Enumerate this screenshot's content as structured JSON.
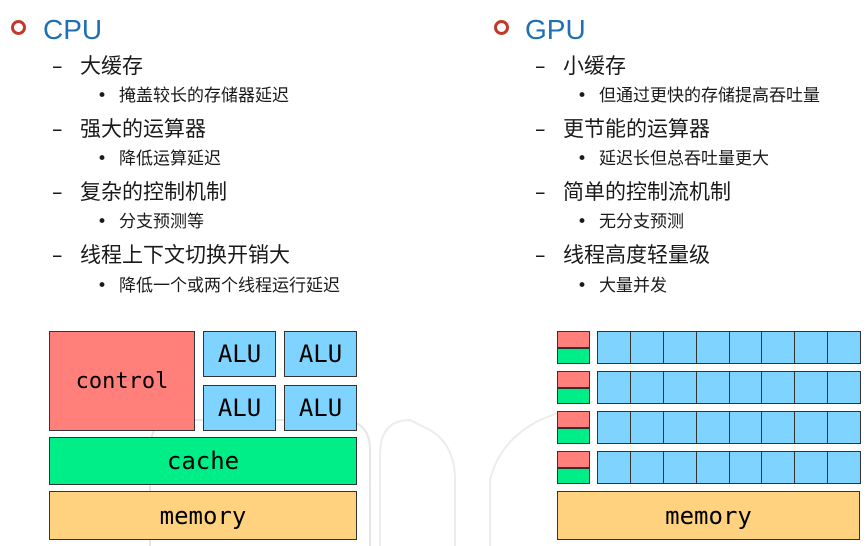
{
  "cpu": {
    "heading": "CPU",
    "items": [
      {
        "title": "大缓存",
        "sub": "掩盖较长的存储器延迟"
      },
      {
        "title": "强大的运算器",
        "sub": "降低运算延迟"
      },
      {
        "title": "复杂的控制机制",
        "sub": "分支预测等"
      },
      {
        "title": "线程上下文切换开销大",
        "sub": "降低一个或两个线程运行延迟"
      }
    ],
    "diagram": {
      "control": "control",
      "alu": [
        "ALU",
        "ALU",
        "ALU",
        "ALU"
      ],
      "cache": "cache",
      "memory": "memory"
    }
  },
  "gpu": {
    "heading": "GPU",
    "items": [
      {
        "title": "小缓存",
        "sub": "但通过更快的存储提高吞吐量"
      },
      {
        "title": "更节能的运算器",
        "sub": "延迟长但总吞吐量更大"
      },
      {
        "title": "简单的控制流机制",
        "sub": "无分支预测"
      },
      {
        "title": "线程高度轻量级",
        "sub": "大量并发"
      }
    ],
    "diagram": {
      "rows": 4,
      "alus_per_row": 8,
      "memory": "memory"
    }
  },
  "symbols": {
    "dash": "–",
    "bullet": "•"
  },
  "colors": {
    "heading": "#1f6fb4",
    "bullet_ring": "#c0392b",
    "control": "#ff7f7a",
    "alu": "#7fd3ff",
    "cache": "#00ee88",
    "memory": "#ffd27f"
  }
}
